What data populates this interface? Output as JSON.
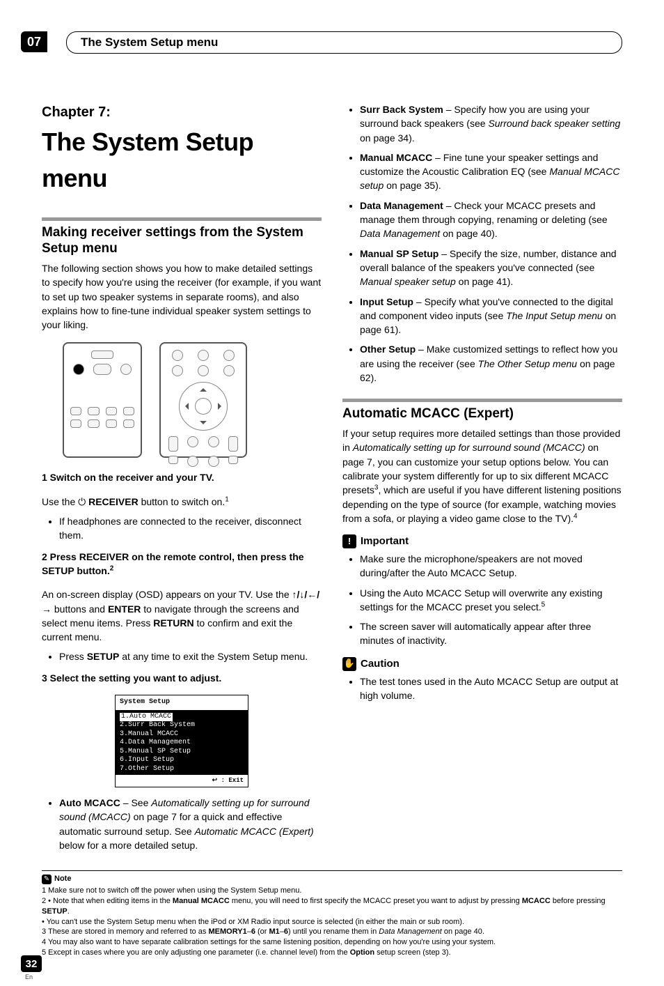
{
  "header": {
    "tab": "07",
    "title": "The System Setup menu"
  },
  "chapter": {
    "label": "Chapter 7:",
    "title": "The System Setup menu"
  },
  "left": {
    "sec1_heading": "Making receiver settings from the System Setup menu",
    "sec1_para": "The following section shows you how to make detailed settings to specify how you're using the receiver (for example, if you want to set up two speaker systems in separate rooms), and also explains how to fine-tune individual speaker system settings to your liking.",
    "step1": "1   Switch on the receiver and your TV.",
    "step1_line_a": "Use the ",
    "step1_line_b": " RECEIVER",
    "step1_line_c": " button to switch on.",
    "step1_sup": "1",
    "step1_bullet": "If headphones are connected to the receiver, disconnect them.",
    "step2a": "2   Press RECEIVER on the remote control, then press the SETUP button.",
    "step2_sup": "2",
    "step2_para_a": "An on-screen display (OSD) appears on your TV. Use the ",
    "step2_para_b": " buttons and ",
    "step2_para_c": "ENTER",
    "step2_para_d": " to navigate through the screens and select menu items. Press ",
    "step2_para_e": "RETURN",
    "step2_para_f": " to confirm and exit the current menu.",
    "step2_bullet_a": "Press ",
    "step2_bullet_b": "SETUP",
    "step2_bullet_c": " at any time to exit the System Setup menu.",
    "step3": "3   Select the setting you want to adjust.",
    "osd": {
      "title": "System Setup",
      "items": [
        "1.Auto MCACC",
        "2.Surr Back System",
        "3.Manual MCACC",
        "4.Data Management",
        "5.Manual SP Setup",
        "6.Input Setup",
        "7.Other Setup"
      ],
      "foot": ": Exit"
    },
    "auto_bullet_a": "Auto MCACC",
    "auto_bullet_b": " – See ",
    "auto_bullet_c": "Automatically setting up for surround sound (MCACC)",
    "auto_bullet_d": " on page 7 for a quick and effective automatic surround setup. See ",
    "auto_bullet_e": "Automatic MCACC (Expert)",
    "auto_bullet_f": " below for a more detailed setup."
  },
  "right": {
    "bullets": [
      {
        "b": "Surr Back System",
        "t1": " – Specify how you are using your surround back speakers (see ",
        "i": "Surround back speaker setting",
        "t2": " on page 34)."
      },
      {
        "b": "Manual MCACC",
        "t1": " – Fine tune your speaker settings and customize the Acoustic Calibration EQ (see ",
        "i": "Manual MCACC setup",
        "t2": " on page 35)."
      },
      {
        "b": "Data Management",
        "t1": " – Check your MCACC presets and manage them through copying, renaming or deleting (see ",
        "i": "Data Management",
        "t2": " on page 40)."
      },
      {
        "b": "Manual SP Setup",
        "t1": " – Specify the size, number, distance and overall balance of the speakers you've connected (see ",
        "i": "Manual speaker setup",
        "t2": " on page 41)."
      },
      {
        "b": "Input Setup",
        "t1": " – Specify what you've connected to the digital and component video inputs (see ",
        "i": "The Input Setup menu",
        "t2": " on page 61)."
      },
      {
        "b": "Other Setup",
        "t1": " – Make customized settings to reflect how you are using the receiver (see ",
        "i": "The Other Setup menu",
        "t2": " on page 62)."
      }
    ],
    "sec2_heading": "Automatic MCACC (Expert)",
    "sec2_para_a": "If your setup requires more detailed settings than those provided in ",
    "sec2_para_b": "Automatically setting up for surround sound (MCACC)",
    "sec2_para_c": " on page 7, you can customize your setup options below. You can calibrate your system differently for up to six different MCACC presets",
    "sec2_sup3": "3",
    "sec2_para_d": ", which are useful if you have different listening positions depending on the type of source (for example, watching movies from a sofa, or playing a video game close to the TV).",
    "sec2_sup4": "4",
    "important_label": "Important",
    "imp1": "Make sure the microphone/speakers are not moved during/after the Auto MCACC Setup.",
    "imp2a": "Using the Auto MCACC Setup will overwrite any existing settings for the MCACC preset you select.",
    "imp2_sup": "5",
    "imp3": "The screen saver will automatically appear after three minutes of inactivity.",
    "caution_label": "Caution",
    "caution1": "The test tones used in the Auto MCACC Setup are output at high volume."
  },
  "footnotes": {
    "note_label": "Note",
    "n1": "1 Make sure not to switch off the power when using the System Setup menu.",
    "n2a": "2 • Note that when editing items in the ",
    "n2b": "Manual MCACC",
    "n2c": " menu, you will need to first specify the MCACC preset you want to adjust by pressing ",
    "n2d": "MCACC",
    "n2e": " before pressing ",
    "n2f": "SETUP",
    "n2g": ".",
    "n2h": "   • You can't use the System Setup menu when the iPod or XM Radio input source is selected (in either the main or sub room).",
    "n3a": "3 These are stored in memory and referred to as ",
    "n3b": "MEMORY1",
    "n3c": "–",
    "n3d": "6",
    "n3e": " (or ",
    "n3f": "M1",
    "n3g": "–",
    "n3h": "6",
    "n3i": ") until you rename them in ",
    "n3j": "Data Management",
    "n3k": " on page 40.",
    "n4": "4 You may also want to have separate calibration settings for the same listening position, depending on how you're using your system.",
    "n5a": "5 Except in cases where you are only adjusting one parameter (i.e. channel level) from the ",
    "n5b": "Option",
    "n5c": " setup screen (step 3)."
  },
  "footer": {
    "page": "32",
    "lang": "En"
  },
  "icons": {
    "power": "⏻",
    "arrows": "↑/↓/←/→",
    "return": "↩"
  }
}
